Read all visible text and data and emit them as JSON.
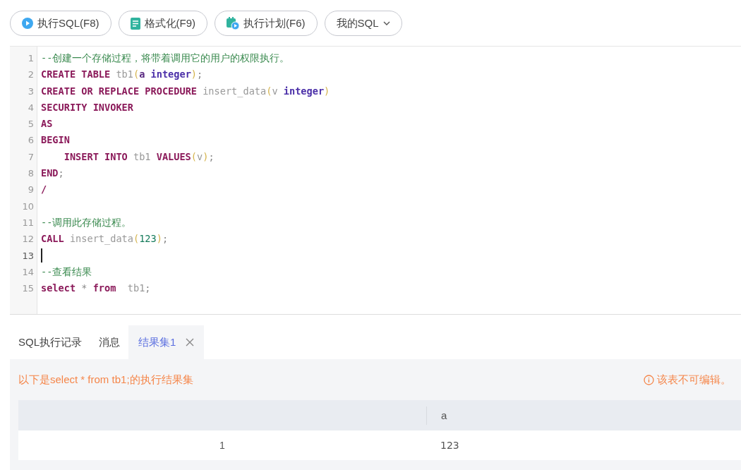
{
  "toolbar": {
    "buttons": [
      {
        "kind": "run",
        "label": "执行SQL(F8)"
      },
      {
        "kind": "format",
        "label": "格式化(F9)"
      },
      {
        "kind": "plan",
        "label": "执行计划(F6)"
      },
      {
        "kind": "menu",
        "label": "我的SQL"
      }
    ]
  },
  "editor": {
    "lines": [
      {
        "number": "1",
        "cursor": false,
        "tokens": [
          {
            "kind": "comment",
            "text": "--创建一个存储过程，将带着调用它的用户的权限执行。"
          }
        ]
      },
      {
        "number": "2",
        "cursor": false,
        "tokens": [
          {
            "kind": "keyword",
            "text": "CREATE "
          },
          {
            "kind": "keyword",
            "text": "TABLE "
          },
          {
            "kind": "ident",
            "text": "tb1"
          },
          {
            "kind": "paren",
            "text": "("
          },
          {
            "kind": "var",
            "text": "a "
          },
          {
            "kind": "type",
            "text": "integer"
          },
          {
            "kind": "paren",
            "text": ")"
          },
          {
            "kind": "punct",
            "text": ";"
          }
        ]
      },
      {
        "number": "3",
        "cursor": false,
        "tokens": [
          {
            "kind": "keyword",
            "text": "CREATE "
          },
          {
            "kind": "keyword",
            "text": "OR "
          },
          {
            "kind": "keyword",
            "text": "REPLACE "
          },
          {
            "kind": "keyword",
            "text": "PROCEDURE "
          },
          {
            "kind": "ident",
            "text": "insert_data"
          },
          {
            "kind": "paren",
            "text": "("
          },
          {
            "kind": "ident",
            "text": "v "
          },
          {
            "kind": "type",
            "text": "integer"
          },
          {
            "kind": "paren",
            "text": ")"
          }
        ]
      },
      {
        "number": "4",
        "cursor": false,
        "tokens": [
          {
            "kind": "keyword",
            "text": "SECURITY "
          },
          {
            "kind": "keyword",
            "text": "INVOKER"
          }
        ]
      },
      {
        "number": "5",
        "cursor": false,
        "tokens": [
          {
            "kind": "keyword",
            "text": "AS"
          }
        ]
      },
      {
        "number": "6",
        "cursor": false,
        "tokens": [
          {
            "kind": "keyword",
            "text": "BEGIN"
          }
        ]
      },
      {
        "number": "7",
        "cursor": false,
        "tokens": [
          {
            "kind": "keyword",
            "text": "    INSERT "
          },
          {
            "kind": "keyword",
            "text": "INTO "
          },
          {
            "kind": "ident",
            "text": "tb1 "
          },
          {
            "kind": "keyword",
            "text": "VALUES"
          },
          {
            "kind": "paren",
            "text": "("
          },
          {
            "kind": "ident",
            "text": "v"
          },
          {
            "kind": "paren",
            "text": ")"
          },
          {
            "kind": "punct",
            "text": ";"
          }
        ]
      },
      {
        "number": "8",
        "cursor": false,
        "tokens": [
          {
            "kind": "keyword",
            "text": "END"
          },
          {
            "kind": "punct",
            "text": ";"
          }
        ]
      },
      {
        "number": "9",
        "cursor": false,
        "tokens": [
          {
            "kind": "keyword",
            "text": "/"
          }
        ]
      },
      {
        "number": "10",
        "cursor": false
      },
      {
        "number": "11",
        "cursor": false,
        "tokens": [
          {
            "kind": "comment",
            "text": "--调用此存储过程。"
          }
        ]
      },
      {
        "number": "12",
        "cursor": false,
        "tokens": [
          {
            "kind": "keyword",
            "text": "CALL "
          },
          {
            "kind": "ident",
            "text": "insert_data"
          },
          {
            "kind": "paren",
            "text": "("
          },
          {
            "kind": "number",
            "text": "123"
          },
          {
            "kind": "paren",
            "text": ")"
          },
          {
            "kind": "punct",
            "text": ";"
          }
        ]
      },
      {
        "number": "13",
        "cursor": true
      },
      {
        "number": "14",
        "cursor": false,
        "tokens": [
          {
            "kind": "comment",
            "text": "--查看结果"
          }
        ]
      },
      {
        "number": "15",
        "cursor": false,
        "tokens": [
          {
            "kind": "keyword",
            "text": "select "
          },
          {
            "kind": "punct",
            "text": "* "
          },
          {
            "kind": "keyword",
            "text": "from  "
          },
          {
            "kind": "ident",
            "text": "tb1"
          },
          {
            "kind": "punct",
            "text": ";"
          }
        ]
      }
    ]
  },
  "result_tabs": [
    {
      "label": "SQL执行记录",
      "selected": false,
      "closable": false
    },
    {
      "label": "消息",
      "selected": false,
      "closable": false
    },
    {
      "label": "结果集1",
      "selected": true,
      "closable": true
    }
  ],
  "result": {
    "message": "以下是select * from tb1;的执行结果集",
    "notice": "该表不可编辑。",
    "table": {
      "columns": [
        "a"
      ],
      "rows": [
        {
          "index": "1",
          "cells": [
            "123"
          ]
        }
      ]
    }
  }
}
